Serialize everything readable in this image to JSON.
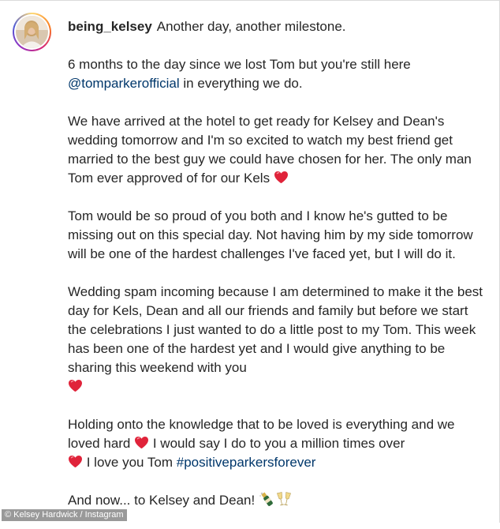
{
  "post": {
    "username": "being_kelsey",
    "intro": "Another day, another milestone.",
    "p1_text": "6 months to the day since we lost Tom but you're still here",
    "p1_mention": "@tomparkerofficial",
    "p1_end": "in everything we do.",
    "p2_text": "We have arrived at the hotel to get ready for Kelsey and Dean's wedding tomorrow and I'm so excited to watch my best friend get married to the best guy we could have chosen for her. The only man Tom ever approved of for our Kels",
    "p3_text": "Tom would be so proud of you both and I know he's gutted to be missing out on this special day. Not having him by my side tomorrow will be one of the hardest challenges I've faced yet, but I will do it.",
    "p4_text": "Wedding spam incoming because I am determined to make it the best day for Kels, Dean and all our friends and family but before we start the celebrations I just wanted to do a little post to my Tom. This week has been one of the hardest yet and I would give anything to be sharing this weekend with you",
    "p5_a": "Holding onto the knowledge that to be loved is everything and we loved hard",
    "p5_b": "I would say I do to you a million times over",
    "p5_c": "I love you Tom",
    "p5_hashtag": "#positiveparkersforever",
    "p6_text": "And now... to Kelsey and Dean!"
  },
  "credit": "© Kelsey Hardwick / Instagram",
  "icons": {
    "heart": "red-heart-icon",
    "bottle": "champagne-bottle-icon",
    "glasses": "clinking-glasses-icon"
  },
  "colors": {
    "text": "#262626",
    "link": "#00376b",
    "heart": "#e0233a"
  }
}
